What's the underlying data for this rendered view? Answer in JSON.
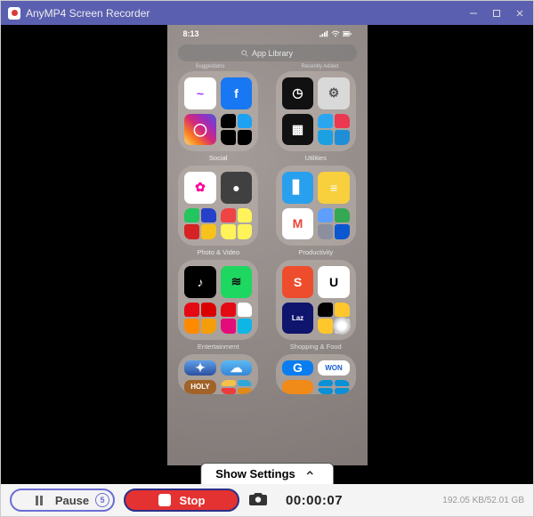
{
  "titlebar": {
    "title": "AnyMP4 Screen Recorder"
  },
  "phone": {
    "time": "8:13",
    "search_label": "App Library",
    "top_categories": [
      "Suggestions",
      "Recently Added"
    ],
    "folders": [
      {
        "label": "Social",
        "apps": [
          {
            "name": "Messenger",
            "bg": "#fff",
            "glyph": "~",
            "fg": "#a033ff"
          },
          {
            "name": "Facebook",
            "bg": "#1877f2",
            "glyph": "f"
          },
          {
            "name": "Instagram",
            "bg": "linear-gradient(45deg,#feda75,#fa7e1e,#d62976,#962fbf,#4f5bd5)",
            "glyph": "◯"
          },
          {
            "name": "mini",
            "tiny": [
              "#000",
              "#1da1f2",
              "#000",
              "#000"
            ]
          }
        ]
      },
      {
        "label": "Utilities",
        "apps": [
          {
            "name": "Clock",
            "bg": "#111",
            "glyph": "◷"
          },
          {
            "name": "Settings",
            "bg": "#d9d9d9",
            "glyph": "⚙",
            "fg": "#555"
          },
          {
            "name": "Calculator",
            "bg": "#111",
            "glyph": "▦"
          },
          {
            "name": "mini",
            "tiny": [
              "#2aa6f0",
              "#ec3750",
              "#1ba1e2",
              "#1e8fd6"
            ]
          }
        ]
      },
      {
        "label": "Photo & Video",
        "apps": [
          {
            "name": "Photos",
            "bg": "#fff",
            "glyph": "✿",
            "fg": "#f09"
          },
          {
            "name": "Camera",
            "bg": "#404040",
            "glyph": "●"
          },
          {
            "name": "mini",
            "tiny": [
              "#23c55e",
              "#2541c9",
              "#d62222",
              "#f6c21b"
            ]
          },
          {
            "name": "mini",
            "tiny": [
              "#ef4444",
              "#fff35a",
              "#fff35a",
              "#fff35a"
            ]
          }
        ]
      },
      {
        "label": "Productivity",
        "apps": [
          {
            "name": "Files",
            "bg": "#29a0ed",
            "glyph": "▋"
          },
          {
            "name": "Notes",
            "bg": "#f8cf3d",
            "glyph": "≡",
            "fg": "#fff"
          },
          {
            "name": "Gmail",
            "bg": "#fff",
            "glyph": "M",
            "fg": "#ea4335"
          },
          {
            "name": "mini",
            "tiny": [
              "#5e9eff",
              "#34a853",
              "#8b8f9e",
              "#0b57d0"
            ]
          }
        ]
      },
      {
        "label": "Entertainment",
        "apps": [
          {
            "name": "TikTok",
            "bg": "#000",
            "glyph": "♪"
          },
          {
            "name": "Spotify",
            "bg": "#1ed760",
            "glyph": "≋",
            "fg": "#111"
          },
          {
            "name": "mini",
            "tiny": [
              "#e50914",
              "#db0000",
              "#ff8a00",
              "#f59e0b"
            ]
          },
          {
            "name": "mini",
            "tiny": [
              "#e50914",
              "#fff",
              "#e40b7b",
              "#0eb6e6"
            ]
          }
        ]
      },
      {
        "label": "Shopping & Food",
        "apps": [
          {
            "name": "Shopee",
            "bg": "#ee4d2d",
            "glyph": "S"
          },
          {
            "name": "Uber",
            "bg": "#fff",
            "glyph": "U",
            "fg": "#000"
          },
          {
            "name": "Lazada",
            "bg": "#0f146d",
            "glyph": "Laz"
          },
          {
            "name": "mini",
            "tiny": [
              "#000",
              "#ffc72c",
              "#ffc72c",
              "#fff"
            ]
          }
        ],
        "assistive": true
      },
      {
        "label": "",
        "apps": [
          {
            "name": "Game",
            "bg": "linear-gradient(#5da0e8,#2d4fa0)",
            "glyph": "✦"
          },
          {
            "name": "Weather",
            "bg": "linear-gradient(#5bb8f4,#3685d6)",
            "glyph": "☁"
          },
          {
            "name": "Holy",
            "bg": "#a16328",
            "glyph": "HOLY"
          },
          {
            "name": "mini",
            "tiny": [
              "#f4c149",
              "#2fa8d8",
              "#ed3b3b",
              "#e08a19"
            ]
          }
        ],
        "half": true
      },
      {
        "label": "",
        "apps": [
          {
            "name": "G",
            "bg": "#0a7df0",
            "glyph": "G"
          },
          {
            "name": "WON",
            "bg": "#fff",
            "glyph": "WON",
            "fg": "#1a5fd0"
          },
          {
            "name": "x",
            "bg": "#f08a19",
            "glyph": ""
          },
          {
            "name": "mini",
            "tiny": [
              "#0a90d6",
              "#0a90d6",
              "#0a90d6",
              "#0a90d6"
            ]
          }
        ],
        "half": true
      }
    ]
  },
  "settings_pill": {
    "label": "Show Settings"
  },
  "controls": {
    "pause_label": "Pause",
    "stop_label": "Stop",
    "badge": "5",
    "timer": "00:00:07",
    "stats": "192.05 KB/52.01 GB"
  }
}
